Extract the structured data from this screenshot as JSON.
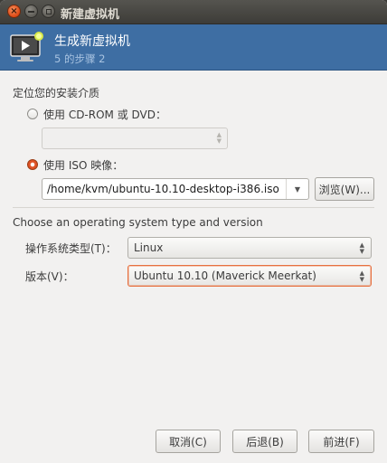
{
  "window": {
    "title": "新建虚拟机",
    "close_glyph": "×"
  },
  "banner": {
    "title": "生成新虚拟机",
    "step": "5 的步骤 2",
    "icon": "vm-monitor-icon"
  },
  "install_media": {
    "heading": "定位您的安装介质",
    "cdrom_label": "使用 CD-ROM 或 DVD：",
    "cdrom_selected": false,
    "cdrom_value": "",
    "iso_label": "使用 ISO 映像：",
    "iso_selected": true,
    "iso_path": "/home/kvm/ubuntu-10.10-desktop-i386.iso",
    "browse_label": "浏览(W)..."
  },
  "os": {
    "heading": "Choose an operating system type and version",
    "type_label": "操作系统类型(T)：",
    "type_value": "Linux",
    "version_label": "版本(V)：",
    "version_value": "Ubuntu 10.10 (Maverick Meerkat)"
  },
  "footer": {
    "cancel_label": "取消(C)",
    "back_label": "后退(B)",
    "forward_label": "前进(F)"
  },
  "colors": {
    "banner_bg": "#3e6ea3",
    "accent": "#dd4814",
    "focus": "#e7703f"
  }
}
